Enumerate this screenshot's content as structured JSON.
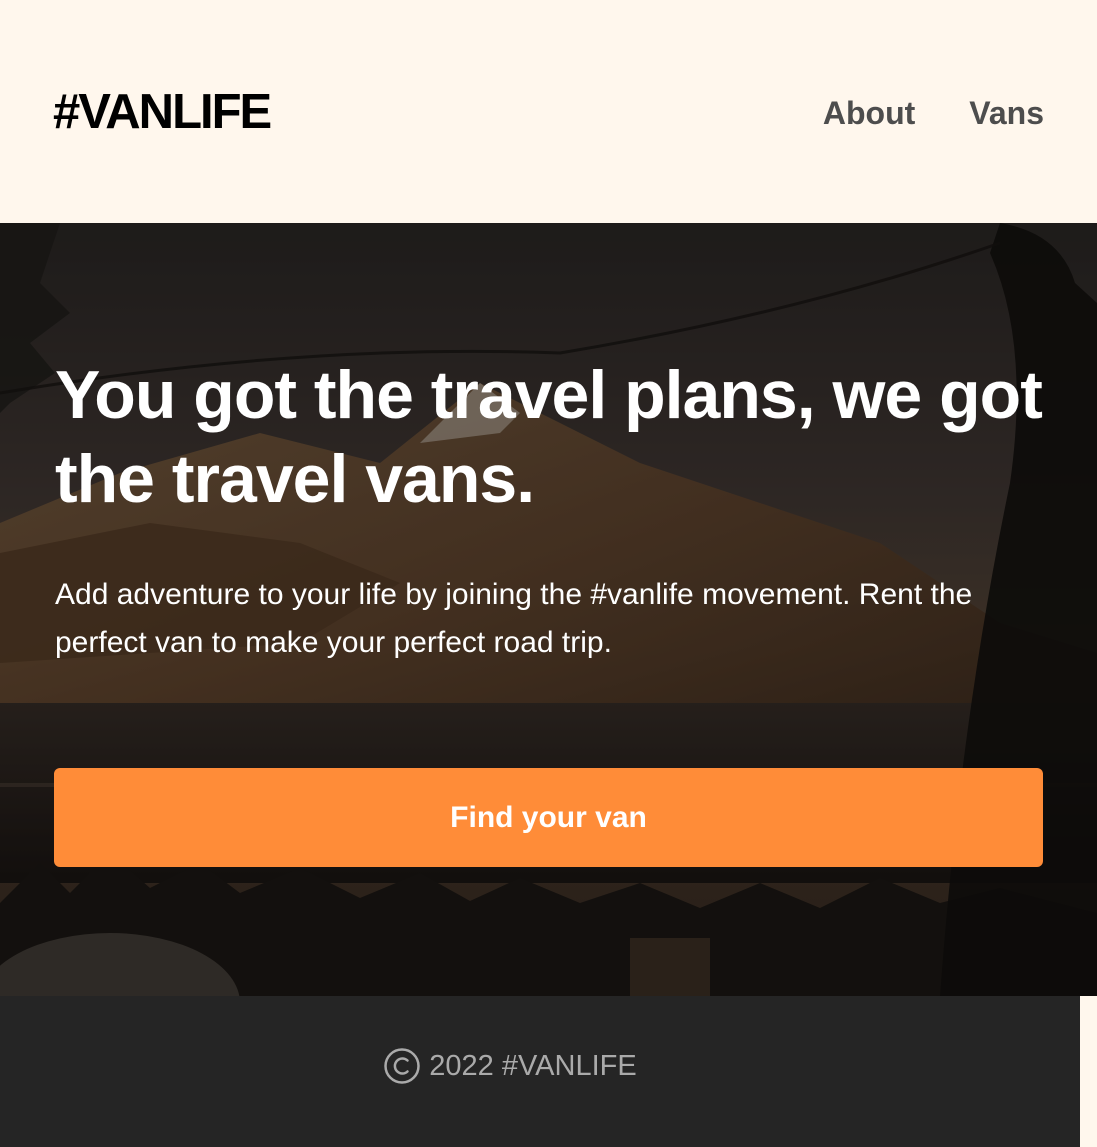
{
  "header": {
    "logo": "#VANLIFE",
    "nav": [
      {
        "label": "About"
      },
      {
        "label": "Vans"
      }
    ]
  },
  "hero": {
    "title": "You got the travel plans, we got the travel vans.",
    "text": "Add adventure to your life by joining the #vanlife movement. Rent the perfect van to make your perfect road trip.",
    "button_label": "Find your van"
  },
  "footer": {
    "copyright_icon": "copyright-icon",
    "text": "2022 #VANLIFE"
  },
  "colors": {
    "background": "#fff7ed",
    "accent": "#ff8c38",
    "footer_bg": "#252525",
    "nav_text": "#4d4d4d"
  }
}
